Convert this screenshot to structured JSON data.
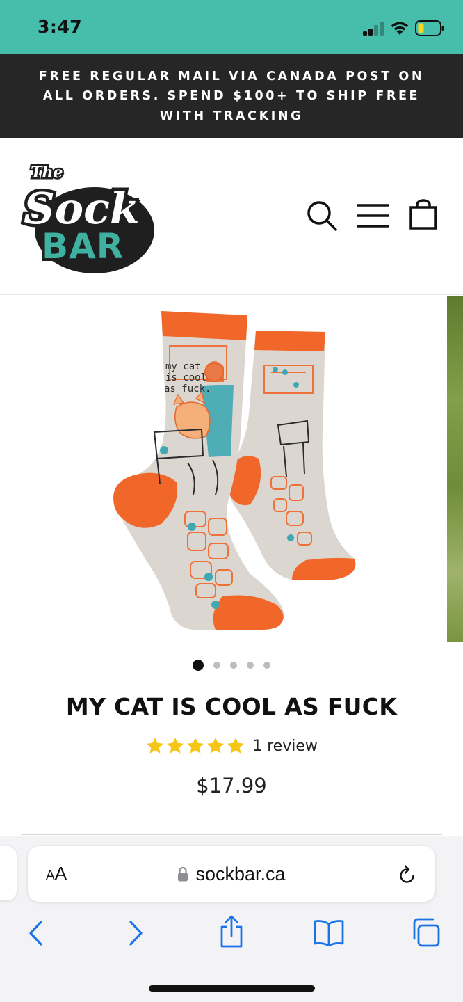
{
  "status_bar": {
    "time": "3:47",
    "background": "#47bdab"
  },
  "promo": {
    "text": "FREE REGULAR MAIL VIA CANADA POST ON ALL ORDERS. SPEND $100+ TO SHIP FREE WITH TRACKING",
    "background": "#262626"
  },
  "header": {
    "logo": {
      "the": "The",
      "sock": "Sock",
      "bar": "BAR",
      "accent": "#3fb1a1"
    },
    "icons": [
      "search-icon",
      "menu-icon",
      "shopping-bag-icon"
    ]
  },
  "gallery": {
    "image_text": {
      "line1": "my cat",
      "line2": "is cool",
      "line3": "as fuck."
    },
    "image_count": 5,
    "active_index": 0,
    "sock_colors": {
      "body": "#dcd6d1",
      "cuff": "#f1672a",
      "teal": "#3fa9b3"
    }
  },
  "product": {
    "title": "MY CAT IS COOL AS FUCK",
    "rating": 5,
    "star_color": "#f5c518",
    "review_count": "1 review",
    "price": "$17.99"
  },
  "browser": {
    "aa_label": "A",
    "aa_label_large": "A",
    "url": "sockbar.ca",
    "toolbar_icons": [
      "back-icon",
      "forward-icon",
      "share-icon",
      "bookmarks-icon",
      "tabs-icon"
    ],
    "accent": "#1a73e8"
  }
}
